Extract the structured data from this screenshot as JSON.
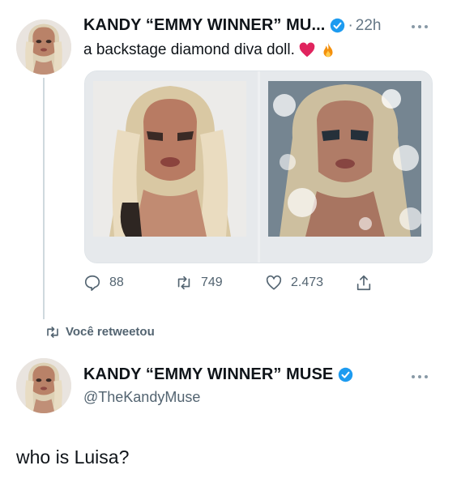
{
  "tweet": {
    "author_name": "KANDY “EMMY WINNER” MU...",
    "separator": "·",
    "time": "22h",
    "text": "a backstage diamond diva doll.",
    "emojis": [
      "heart-emoji",
      "fire-emoji"
    ],
    "stats": {
      "replies": "88",
      "retweets": "749",
      "likes": "2.473"
    }
  },
  "retweet_notice": "Você retweetou",
  "profile": {
    "author_name": "KANDY “EMMY WINNER” MUSE",
    "handle": "@TheKandyMuse"
  },
  "comment_text": "who is Luisa?",
  "colors": {
    "verified_blue": "#1d9bf0",
    "text_secondary": "#536471",
    "heart_red": "#e0245e",
    "fire_orange": "#f4900c"
  },
  "icons": [
    "verified-badge-icon",
    "more-options-icon",
    "reply-icon",
    "retweet-icon",
    "like-icon",
    "share-icon"
  ]
}
